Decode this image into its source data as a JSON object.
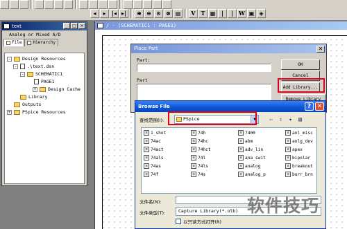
{
  "toolbar": {
    "text_buttons": [
      "V",
      "T",
      "W"
    ]
  },
  "project_panel": {
    "title": "text",
    "subtitle": "Analog or Mixed A/D",
    "tabs": [
      "File",
      "Hierarchy"
    ],
    "tree": [
      {
        "label": "Design Resources",
        "type": "folder",
        "expand": "-"
      },
      {
        "label": ".\\text.dsn",
        "type": "doc",
        "expand": "-"
      },
      {
        "label": "SCHEMATIC1",
        "type": "folder",
        "expand": "-"
      },
      {
        "label": "PAGE1",
        "type": "doc",
        "expand": ""
      },
      {
        "label": "Design Cache",
        "type": "folder",
        "expand": "+"
      },
      {
        "label": "Library",
        "type": "folder",
        "expand": ""
      },
      {
        "label": "Outputs",
        "type": "folder",
        "expand": ""
      },
      {
        "label": "PSpice Resources",
        "type": "folder",
        "expand": "+"
      }
    ]
  },
  "schematic": {
    "title": "/ - (SCHEMATIC1 : PAGE1)"
  },
  "place_part": {
    "title": "Place Part",
    "part_label": "Part:",
    "part_list_label": "Part",
    "ok_label": "OK",
    "cancel_label": "Cancel",
    "add_library_label": "Add Library...",
    "remove_library_label": "Remove Library"
  },
  "browse_file": {
    "title": "Browse File",
    "look_in_label": "查找范围(I):",
    "look_in_value": "PSpice",
    "files_col1": [
      "1_shot",
      "74ac",
      "74act",
      "74als",
      "74as",
      "74f"
    ],
    "files_col2": [
      "74h",
      "74hc",
      "74hct",
      "74l",
      "74ls",
      "74s"
    ],
    "files_col3": [
      "7400",
      "abm",
      "adv_lin",
      "ana_swit",
      "analog",
      "analog_p"
    ],
    "files_col4": [
      "anl_misc",
      "anlg_dev",
      "apex",
      "bipolar",
      "breakout",
      "burr_brn"
    ],
    "filename_label": "文件名(N):",
    "filename_value": "",
    "filetype_label": "文件类型(T):",
    "filetype_value": "Capture Library(*.olb)",
    "readonly_label": "以只读方式打开(R)"
  },
  "watermark": "软件技巧",
  "colors": {
    "highlight_box": "#e0001a",
    "xp_titlebar": "#0a55d6",
    "classic_titlebar": "#0a246a"
  }
}
